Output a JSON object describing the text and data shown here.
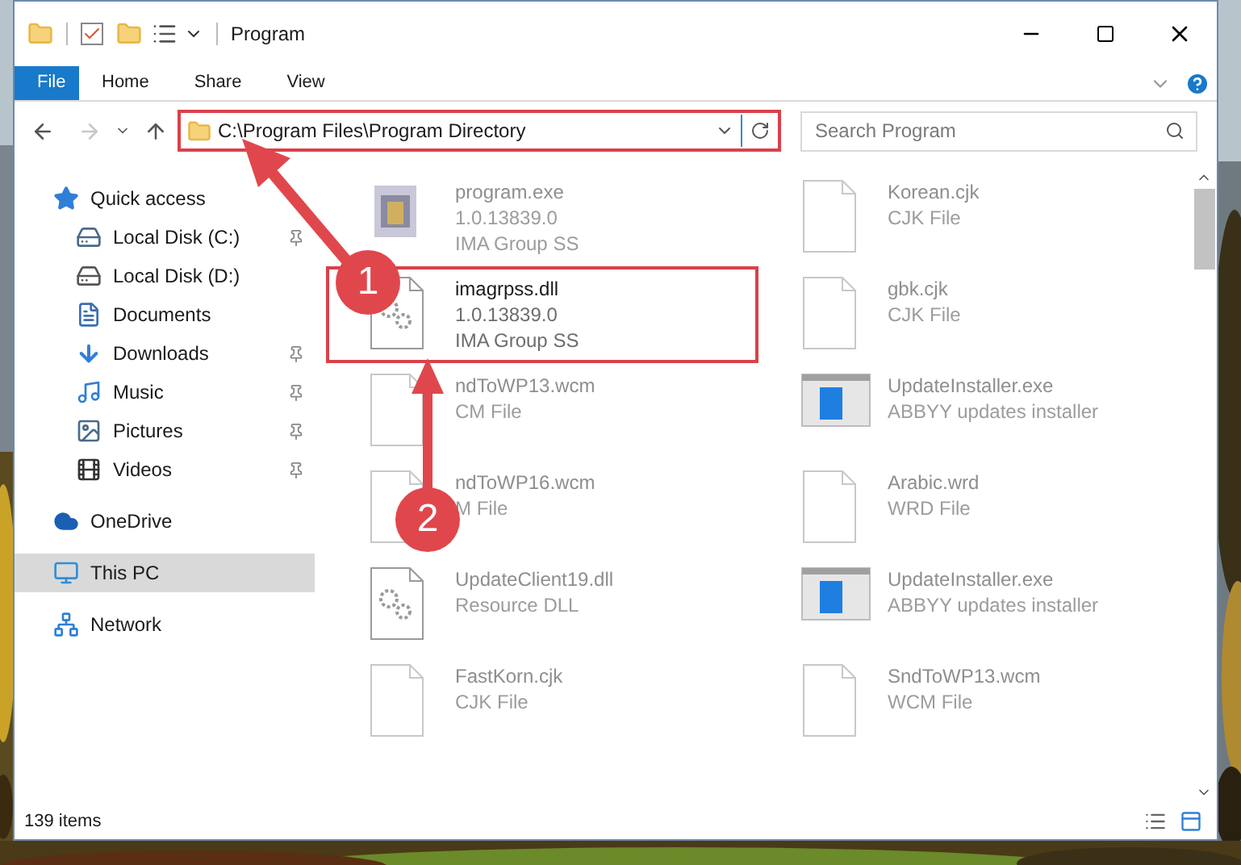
{
  "window": {
    "title": "Program"
  },
  "ribbon": {
    "tabs": [
      {
        "label": "File",
        "selected": true
      },
      {
        "label": "Home",
        "selected": false
      },
      {
        "label": "Share",
        "selected": false
      },
      {
        "label": "View",
        "selected": false
      }
    ]
  },
  "address": {
    "path": "C:\\Program Files\\Program Directory"
  },
  "search": {
    "placeholder": "Search Program"
  },
  "sidebar": {
    "items": [
      {
        "label": "Quick access",
        "kind": "star",
        "selected": false,
        "children": [
          {
            "label": "Local Disk (C:)",
            "kind": "drive-c",
            "pinned": true,
            "selected": false
          },
          {
            "label": "Local Disk (D:)",
            "kind": "drive",
            "pinned": false,
            "selected": false
          },
          {
            "label": "Documents",
            "kind": "documents",
            "pinned": false,
            "selected": false
          },
          {
            "label": "Downloads",
            "kind": "downloads",
            "pinned": true,
            "selected": false
          },
          {
            "label": "Music",
            "kind": "music",
            "pinned": true,
            "selected": false
          },
          {
            "label": "Pictures",
            "kind": "pictures",
            "pinned": true,
            "selected": false
          },
          {
            "label": "Videos",
            "kind": "videos",
            "pinned": true,
            "selected": false
          }
        ]
      },
      {
        "label": "OneDrive",
        "kind": "cloud",
        "selected": false
      },
      {
        "label": "This PC",
        "kind": "pc",
        "selected": true
      },
      {
        "label": "Network",
        "kind": "network",
        "selected": false
      }
    ]
  },
  "files": [
    {
      "name": "program.exe",
      "details": [
        "1.0.13839.0",
        "IMA Group SS"
      ],
      "kind": "app",
      "dimmed": true,
      "highlighted": false
    },
    {
      "name": "Korean.cjk",
      "details": [
        "CJK File"
      ],
      "kind": "doc",
      "dimmed": true,
      "highlighted": false
    },
    {
      "name": "imagrpss.dll",
      "details": [
        "1.0.13839.0",
        "IMA Group SS"
      ],
      "kind": "gear",
      "dimmed": false,
      "highlighted": true
    },
    {
      "name": "gbk.cjk",
      "details": [
        "CJK File"
      ],
      "kind": "doc",
      "dimmed": true,
      "highlighted": false
    },
    {
      "name": "ndToWP13.wcm",
      "details": [
        "CM File"
      ],
      "kind": "doc",
      "dimmed": true,
      "highlighted": false
    },
    {
      "name": "UpdateInstaller.exe",
      "details": [
        "ABBYY updates installer"
      ],
      "kind": "installer",
      "dimmed": true,
      "highlighted": false
    },
    {
      "name": "ndToWP16.wcm",
      "details": [
        "M File"
      ],
      "kind": "doc",
      "dimmed": true,
      "highlighted": false
    },
    {
      "name": "Arabic.wrd",
      "details": [
        "WRD File"
      ],
      "kind": "doc",
      "dimmed": true,
      "highlighted": false
    },
    {
      "name": "UpdateClient19.dll",
      "details": [
        "Resource DLL"
      ],
      "kind": "gear",
      "dimmed": true,
      "highlighted": false
    },
    {
      "name": "UpdateInstaller.exe",
      "details": [
        "ABBYY updates installer"
      ],
      "kind": "installer",
      "dimmed": true,
      "highlighted": false
    },
    {
      "name": "FastKorn.cjk",
      "details": [
        "CJK File"
      ],
      "kind": "doc",
      "dimmed": true,
      "highlighted": false
    },
    {
      "name": "SndToWP13.wcm",
      "details": [
        "WCM File"
      ],
      "kind": "doc",
      "dimmed": true,
      "highlighted": false
    }
  ],
  "status_bar": {
    "count": "139 items"
  },
  "annotations": [
    {
      "label": "1"
    },
    {
      "label": "2"
    }
  ]
}
